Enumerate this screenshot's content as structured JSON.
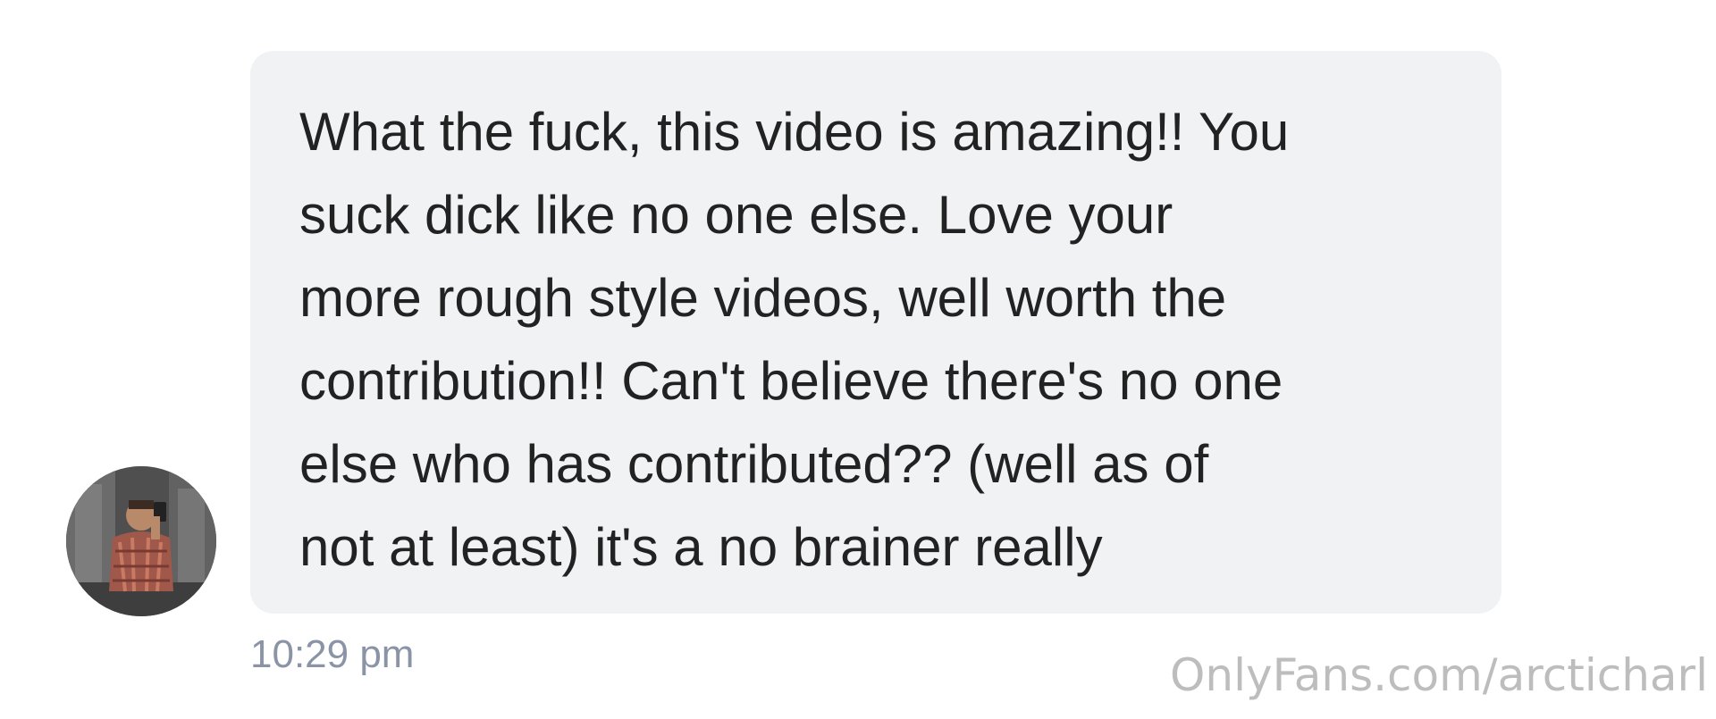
{
  "message": {
    "text": "What the fuck, this video is amazing!! You\nsuck dick like no one else. Love your\nmore rough style videos, well worth the\ncontribution!! Can't believe there's no one\nelse who has contributed?? (well as of\nnot at least) it's a no brainer really",
    "timestamp": "10:29 pm",
    "bubble_color": "#f1f2f4",
    "text_color": "#222222",
    "timestamp_color": "#8a94a6"
  },
  "sender": {
    "avatar_icon": "user-photo-avatar"
  },
  "watermark": {
    "text": "OnlyFans.com/arcticharl",
    "color": "#bdbdbd"
  }
}
